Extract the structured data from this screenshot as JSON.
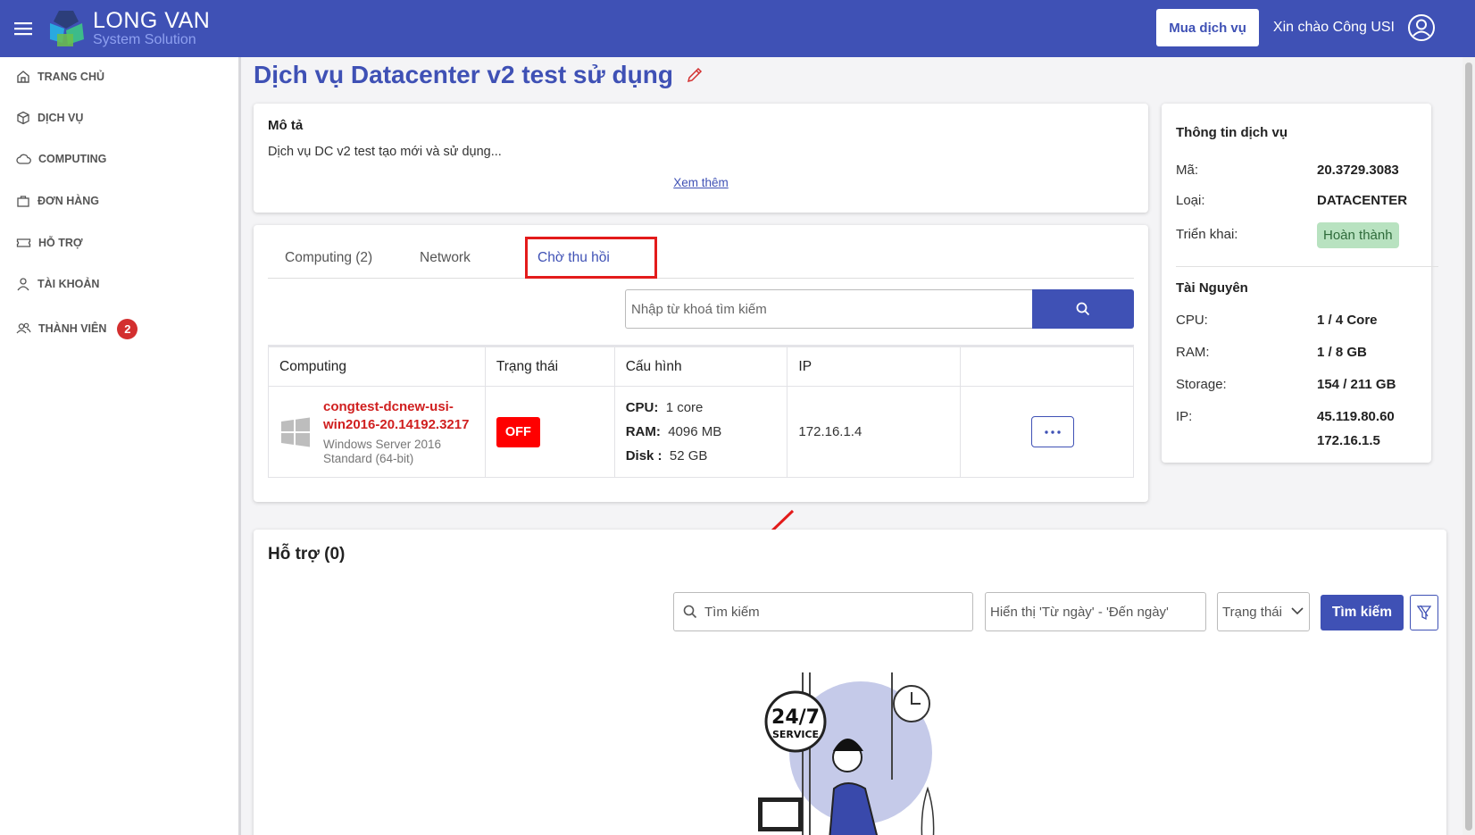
{
  "header": {
    "logo_main": "LONG VAN",
    "logo_sub": "System Solution",
    "buy_label": "Mua dịch vụ",
    "greeting": "Xin chào Công USI"
  },
  "sidebar": {
    "items": [
      {
        "label": "TRANG CHỦ",
        "icon": "home-icon"
      },
      {
        "label": "DỊCH VỤ",
        "icon": "box-icon"
      },
      {
        "label": "COMPUTING",
        "icon": "cloud-icon"
      },
      {
        "label": "ĐƠN HÀNG",
        "icon": "bag-icon"
      },
      {
        "label": "HỖ TRỢ",
        "icon": "ticket-icon"
      },
      {
        "label": "TÀI KHOẢN",
        "icon": "user-icon"
      },
      {
        "label": "THÀNH VIÊN",
        "icon": "users-icon",
        "badge": "2"
      }
    ]
  },
  "page": {
    "title": "Dịch vụ Datacenter v2 test sử dụng"
  },
  "description": {
    "label": "Mô tả",
    "text": "Dịch vụ DC v2 test tạo mới và sử dụng...",
    "more": "Xem thêm"
  },
  "tabs": [
    {
      "label": "Computing (2)"
    },
    {
      "label": "Network"
    },
    {
      "label": "Chờ thu hồi",
      "active": true
    }
  ],
  "search": {
    "placeholder": "Nhập từ khoá tìm kiếm"
  },
  "table": {
    "headers": [
      "Computing",
      "Trạng thái",
      "Cấu hình",
      "IP",
      ""
    ],
    "rows": [
      {
        "name": "congtest-dcnew-usi-win2016-20.14192.3217",
        "os": "Windows Server 2016 Standard (64-bit)",
        "status": "OFF",
        "cpu_label": "CPU:",
        "cpu": "1 core",
        "ram_label": "RAM:",
        "ram": "4096 MB",
        "disk_label": "Disk :",
        "disk": "52 GB",
        "ip": "172.16.1.4"
      }
    ]
  },
  "service_info": {
    "title": "Thông tin dịch vụ",
    "code_label": "Mã:",
    "code": "20.3729.3083",
    "type_label": "Loại:",
    "type": "DATACENTER",
    "deploy_label": "Triển khai:",
    "deploy": "Hoàn thành",
    "resource_title": "Tài Nguyên",
    "cpu_label": "CPU:",
    "cpu": "1 / 4 Core",
    "ram_label": "RAM:",
    "ram": "1 / 8 GB",
    "storage_label": "Storage:",
    "storage": "154 / 211 GB",
    "ip_label": "IP:",
    "ip1": "45.119.80.60",
    "ip2": "172.16.1.5"
  },
  "support": {
    "title": "Hỗ trợ (0)",
    "search_placeholder": "Tìm kiếm",
    "date_placeholder": "Hiển thị 'Từ ngày' - 'Đến ngày'",
    "status_label": "Trạng thái",
    "search_button": "Tìm kiếm",
    "illustration_text1": "24/7",
    "illustration_text2": "SERVICE"
  },
  "colors": {
    "primary": "#3f51b5",
    "danger": "#ff0000",
    "success_bg": "#b8e2c0"
  }
}
